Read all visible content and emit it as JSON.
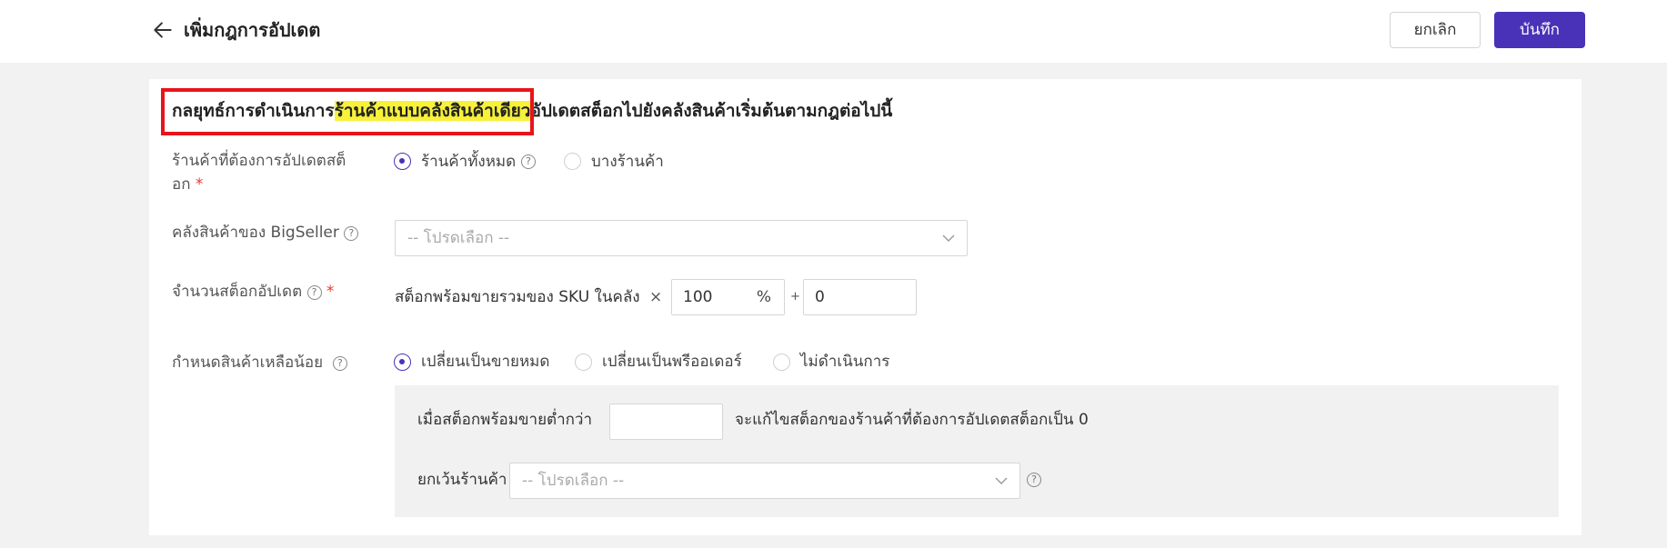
{
  "header": {
    "title": "เพิ่มกฎการอัปเดต",
    "cancel_label": "ยกเลิก",
    "save_label": "บันทึก"
  },
  "heading": {
    "prefix": "กลยุทธ์การดำเนินการ",
    "highlight": "ร้านค้าแบบคลังสินค้าเดียว",
    "suffix": "อัปเดตสต็อกไปยังคลังสินค้าเริ่มต้นตามกฎต่อไปนี้"
  },
  "shops": {
    "label_line1": "ร้านค้าที่ต้องการอัปเดตสต็",
    "label_line2": "อก",
    "required_mark": "*",
    "options": [
      "ร้านค้าทั้งหมด",
      "บางร้านค้า"
    ],
    "selected": "ร้านค้าทั้งหมด"
  },
  "warehouse": {
    "label": "คลังสินค้าของ BigSeller",
    "placeholder": "-- โปรดเลือก --"
  },
  "stock_qty": {
    "label": "จำนวนสต็อกอัปเดต",
    "required_mark": "*",
    "formula_text": "สต็อกพร้อมขายรวมของ SKU ในคลัง",
    "times": "×",
    "percent_value": "100",
    "percent_unit": "%",
    "plus": "+",
    "add_value": "0"
  },
  "low_stock": {
    "label": "กำหนดสินค้าเหลือน้อย",
    "options": [
      "เปลี่ยนเป็นขายหมด",
      "เปลี่ยนเป็นพรีออเดอร์",
      "ไม่ดำเนินการ"
    ],
    "selected": "เปลี่ยนเป็นขายหมด",
    "threshold_label": "เมื่อสต็อกพร้อมขายต่ำกว่า",
    "threshold_value": "",
    "threshold_suffix": "จะแก้ไขสต็อกของร้านค้าที่ต้องการอัปเดตสต็อกเป็น 0",
    "except_label": "ยกเว้นร้านค้า",
    "except_placeholder": "-- โปรดเลือก --"
  },
  "colors": {
    "primary": "#4a32b8",
    "highlight": "#f7f13a",
    "annotation_box": "#e8141a",
    "required": "#e53935"
  },
  "icons": [
    "back-arrow-icon",
    "help-icon",
    "chevron-down-icon"
  ]
}
